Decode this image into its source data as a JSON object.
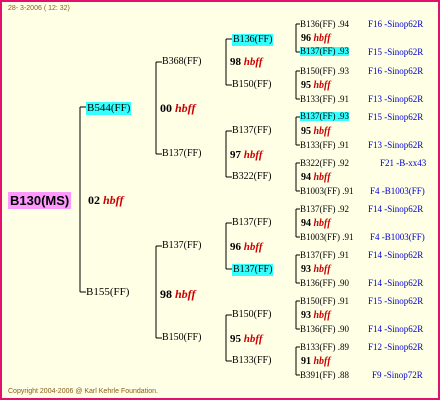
{
  "header": {
    "date": "28- 3-2006",
    "time": "( 12: 32)"
  },
  "footer": {
    "copyright": "Copyright 2004-2006 @ Karl Kehrle Foundation."
  },
  "root": {
    "label": "B130(MS)"
  },
  "g1": [
    {
      "label": "B544(FF)",
      "num": "00",
      "tag": "hbff"
    },
    {
      "label": "B155(FF)",
      "num": "98",
      "tag": "hbff"
    }
  ],
  "root_sub": {
    "num": "02",
    "tag": "hbff"
  },
  "g2": [
    {
      "label": "B368(FF)",
      "num": "98",
      "tag": "hbff"
    },
    {
      "label": "B137(FF)",
      "num": "97",
      "tag": "hbff"
    },
    {
      "label": "B137(FF)",
      "num": "96",
      "tag": "hbff"
    },
    {
      "label": "B150(FF)",
      "num": "95",
      "tag": "hbff"
    }
  ],
  "g3": [
    {
      "label": "B136(FF)",
      "num": "96",
      "tag": "hbff"
    },
    {
      "label": "B150(FF)",
      "num": "95",
      "tag": "hbff"
    },
    {
      "label": "B137(FF)",
      "num": "95",
      "tag": "hbff"
    },
    {
      "label": "B322(FF)",
      "num": "94",
      "tag": "hbff"
    },
    {
      "label": "B137(FF)",
      "num": "94",
      "tag": "hbff"
    },
    {
      "label": "B137(FF)",
      "num": "93",
      "tag": "hbff"
    },
    {
      "label": "B150(FF)",
      "num": "93",
      "tag": "hbff"
    },
    {
      "label": "B133(FF)",
      "num": "91",
      "tag": "hbff"
    }
  ],
  "g4": [
    {
      "label": "B136(FF)",
      "pct": ".94",
      "line": "F16 -Sinop62R"
    },
    {
      "label": "B137(FF)",
      "pct": ".93",
      "line": "F15 -Sinop62R"
    },
    {
      "label": "B150(FF)",
      "pct": ".93",
      "line": "F16 -Sinop62R"
    },
    {
      "label": "B133(FF)",
      "pct": ".91",
      "line": "F13 -Sinop62R"
    },
    {
      "label": "B137(FF)",
      "pct": ".93",
      "line": "F15 -Sinop62R"
    },
    {
      "label": "B133(FF)",
      "pct": ".91",
      "line": "F13 -Sinop62R"
    },
    {
      "label": "B322(FF)",
      "pct": ".92",
      "line": "F21 -B-xx43"
    },
    {
      "label": "B1003(FF)",
      "pct": ".91",
      "line": "F4 -B1003(FF)"
    },
    {
      "label": "B137(FF)",
      "pct": ".92",
      "line": "F14 -Sinop62R"
    },
    {
      "label": "B1003(FF)",
      "pct": ".91",
      "line": "F4 -B1003(FF)"
    },
    {
      "label": "B137(FF)",
      "pct": ".91",
      "line": "F14 -Sinop62R"
    },
    {
      "label": "B136(FF)",
      "pct": ".90",
      "line": "F14 -Sinop62R"
    },
    {
      "label": "B150(FF)",
      "pct": ".91",
      "line": "F15 -Sinop62R"
    },
    {
      "label": "B136(FF)",
      "pct": ".90",
      "line": "F14 -Sinop62R"
    },
    {
      "label": "B133(FF)",
      "pct": ".89",
      "line": "F12 -Sinop62R"
    },
    {
      "label": "B391(FF)",
      "pct": ".88",
      "line": "F9 -Sinop72R"
    }
  ],
  "colors": {
    "border": "#e0106c",
    "background": "#ffffe6",
    "root_highlight": "#ff99ff",
    "node_highlight": "#33ffff",
    "tag": "#cc0000",
    "line_ref": "#0000cc"
  }
}
